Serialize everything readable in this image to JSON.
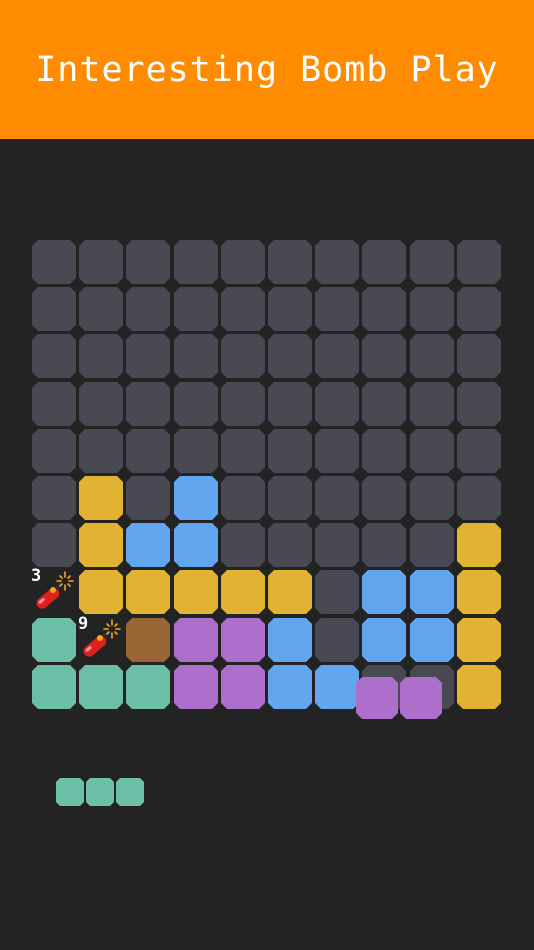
{
  "header": {
    "title": "Interesting Bomb Play"
  },
  "colors": {
    "empty": "#484953",
    "yellow": "#e2b232",
    "blue": "#61a6ef",
    "teal": "#6bbfa6",
    "purple": "#ad6fcc",
    "brown": "#9a6534",
    "bomb": "#e0201e",
    "fuse_spark": "#f6a623"
  },
  "board": {
    "rows": 10,
    "cols": 10,
    "cells": [
      "..........",
      "..........",
      "..........",
      "..........",
      "..........",
      ".Y.B......",
      ".YBB.....Y",
      "bYYYYY.BBY",
      "TbrPPB.BBY",
      "TTTPPBB..Y"
    ],
    "bombs": [
      {
        "row": 7,
        "col": 0,
        "count": "3"
      },
      {
        "row": 8,
        "col": 1,
        "count": "9"
      }
    ]
  },
  "held_piece": {
    "color": "purple",
    "cells": 2,
    "icon": "dragged-block"
  },
  "next_piece": {
    "color": "teal",
    "cells": 3
  }
}
